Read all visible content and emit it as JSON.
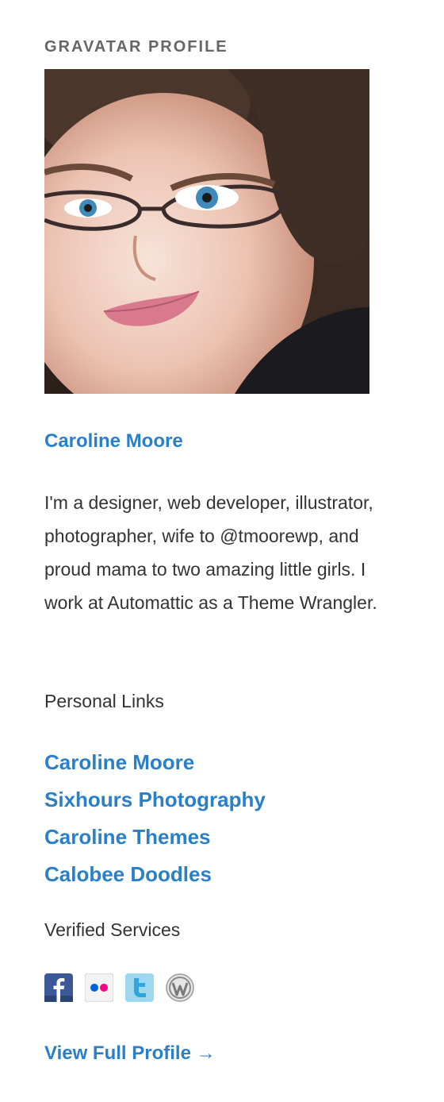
{
  "widget": {
    "title": "GRAVATAR PROFILE",
    "name": "Caroline Moore",
    "bio": "I'm a designer, web developer, illustrator, photographer, wife to @tmoorewp, and proud mama to two amazing little girls. I work at Automattic as a Theme Wrangler.",
    "personal_links_heading": "Personal Links",
    "personal_links": [
      "Caroline Moore",
      "Sixhours Photography",
      "Caroline Themes",
      "Calobee Doodles"
    ],
    "verified_services_heading": "Verified Services",
    "verified_services": [
      "facebook-icon",
      "flickr-icon",
      "twitter-icon",
      "wordpress-icon"
    ],
    "full_profile_label": "View Full Profile →"
  },
  "colors": {
    "link": "#2a7fc9",
    "text": "#333333",
    "title": "#666666",
    "background": "#ffffff"
  }
}
